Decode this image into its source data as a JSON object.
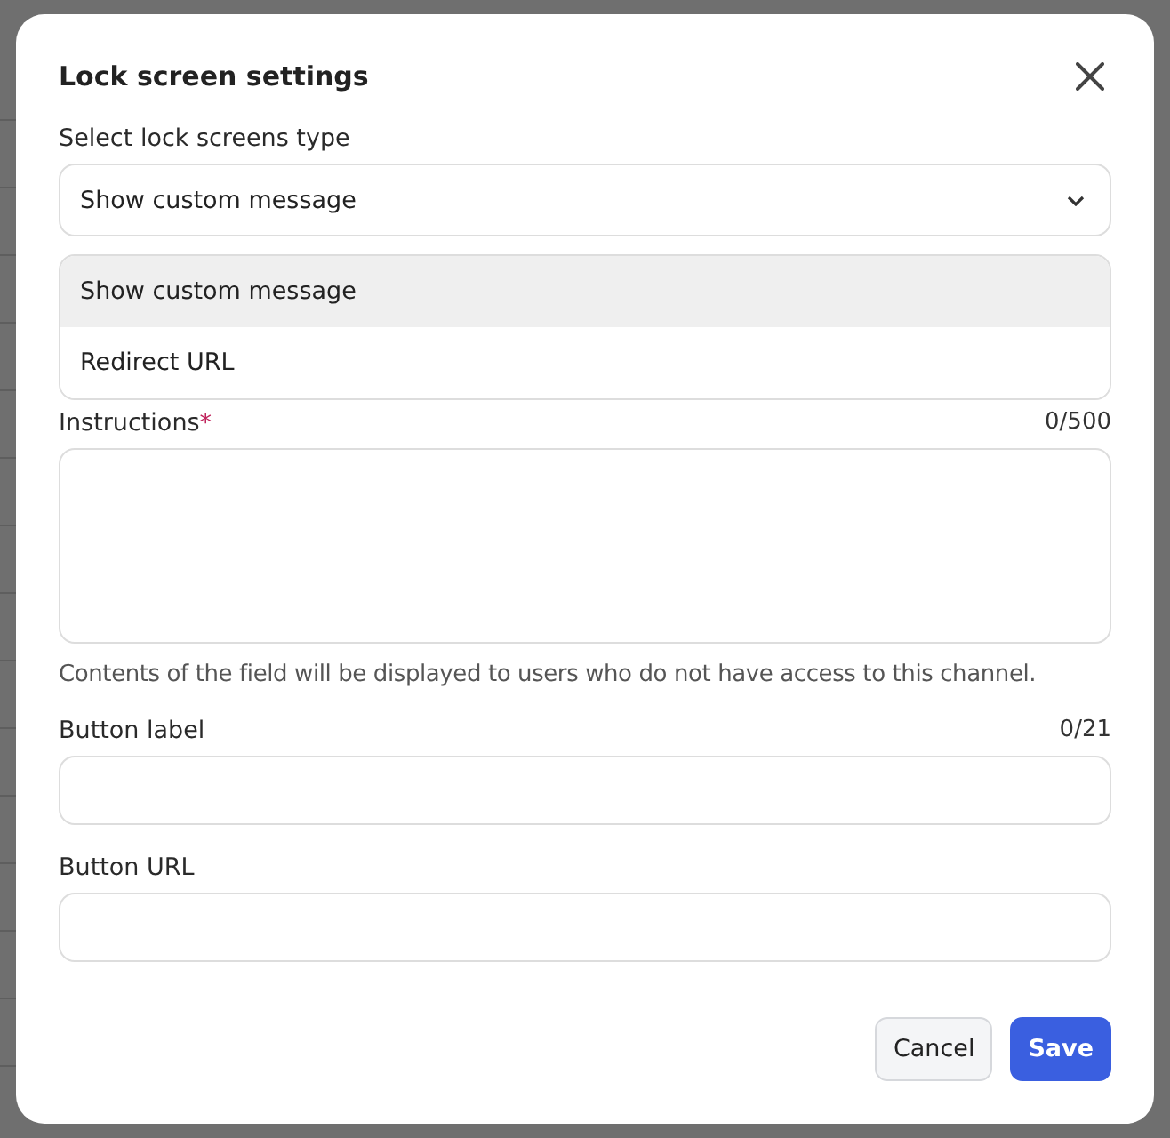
{
  "dialog": {
    "title": "Lock screen settings",
    "type_field": {
      "label": "Select lock screens type",
      "value": "Show custom message",
      "expanded": true,
      "options": [
        {
          "label": "Show custom message",
          "selected": true
        },
        {
          "label": "Redirect URL",
          "selected": false
        }
      ]
    },
    "instructions": {
      "label": "Instructions",
      "required_mark": "*",
      "counter": "0/500"
    },
    "help_text": "Contents of the field will be displayed to users who do not have access to this channel.",
    "button_label": {
      "label": "Button label",
      "counter": "0/21"
    },
    "button_url": {
      "label": "Button URL"
    },
    "buttons": [
      {
        "label": "Cancel",
        "kind": "secondary"
      },
      {
        "label": "Save",
        "kind": "primary"
      }
    ]
  }
}
